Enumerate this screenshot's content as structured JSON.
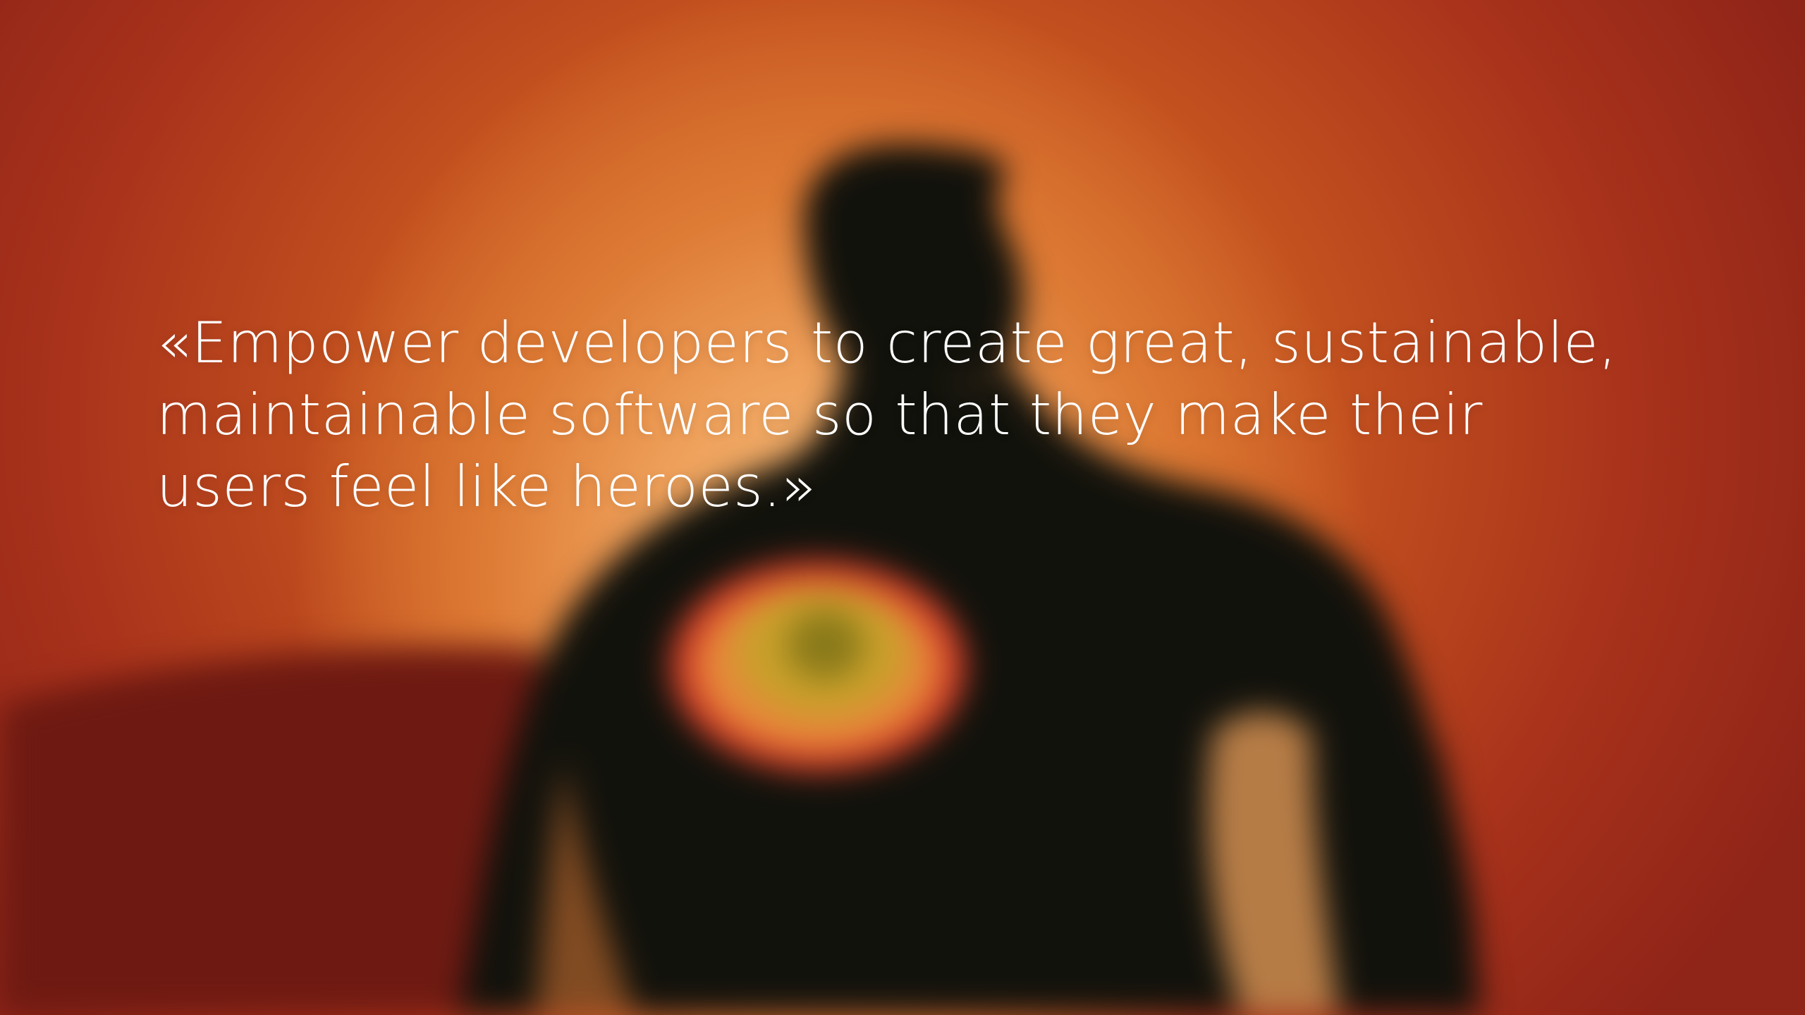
{
  "slide": {
    "background_colors": {
      "edge_red": "#8f2418",
      "mid_orange": "#d9722c",
      "glow": "#f6c080",
      "silhouette": "#12120c",
      "cape": "#6e1a12",
      "emblem_outer": "#d8402a",
      "emblem_inner": "#c9a02a"
    },
    "quote": {
      "lines": [
        "«Empower developers to create great, sustainable,",
        "maintainable software so that they make their",
        "users feel like heroes.»"
      ]
    },
    "illustration": {
      "icon": "superhero-silhouette-icon"
    }
  }
}
